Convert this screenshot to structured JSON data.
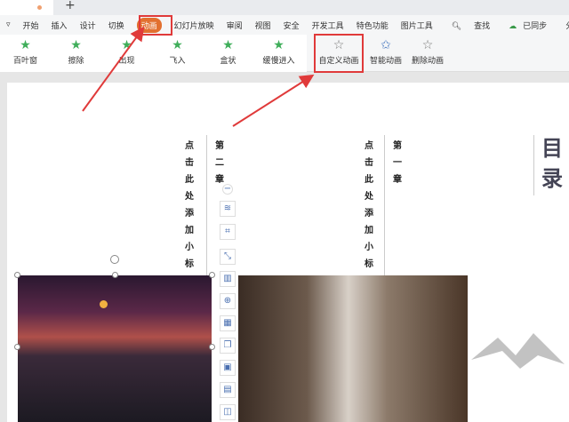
{
  "tabbar": {
    "new_tab": "+"
  },
  "menu": {
    "items": [
      "开始",
      "插入",
      "设计",
      "切换",
      "动画",
      "幻灯片放映",
      "审阅",
      "视图",
      "安全",
      "开发工具",
      "特色功能",
      "图片工具"
    ],
    "active": "动画",
    "search": "查找",
    "sync": "已同步",
    "share": "分"
  },
  "ribbon": {
    "effects": [
      "百叶窗",
      "擦除",
      "出现",
      "飞入",
      "盒状",
      "缓慢进入"
    ],
    "custom": "自定义动画",
    "smart": "智能动画",
    "delete": "删除动画"
  },
  "slide": {
    "toc_title": "目录",
    "chapter1": "第一章",
    "chapter2": "第二章",
    "subtitle1": "点击此处添加小标题",
    "subtitle2": "点击此处添加小标题"
  },
  "colors": {
    "accent": "#e2702f",
    "highlight": "#e03a3a"
  }
}
